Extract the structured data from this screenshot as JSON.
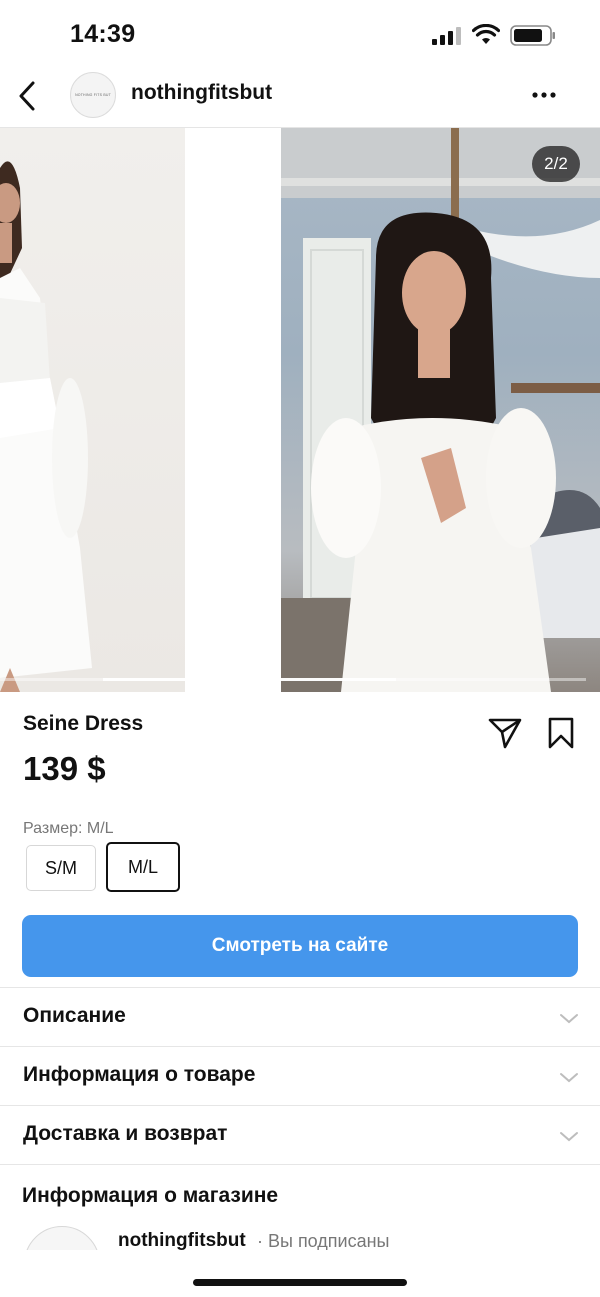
{
  "status_bar": {
    "time": "14:39"
  },
  "header": {
    "shop_name": "nothingfitsbut",
    "avatar_text": "NOTHING FITS BUT"
  },
  "carousel": {
    "page_indicator": "2/2",
    "progress": 0.5
  },
  "product": {
    "name": "Seine Dress",
    "price": "139 $"
  },
  "sizes": {
    "label": "Размер: M/L",
    "options": [
      "S/M",
      "M/L"
    ],
    "selected": "M/L"
  },
  "cta": {
    "label": "Смотреть на сайте"
  },
  "sections": [
    {
      "label": "Описание"
    },
    {
      "label": "Информация о товаре"
    },
    {
      "label": "Доставка и возврат"
    }
  ],
  "store": {
    "title": "Информация о магазине",
    "name": "nothingfitsbut",
    "status": "· Вы подписаны"
  },
  "colors": {
    "accent": "#4596ec",
    "text": "#111111",
    "muted": "#777777"
  },
  "icons": [
    "back-arrow-icon",
    "more-dots-icon",
    "share-icon",
    "bookmark-icon",
    "chevron-down-icon",
    "signal-icon",
    "wifi-icon",
    "battery-icon"
  ]
}
